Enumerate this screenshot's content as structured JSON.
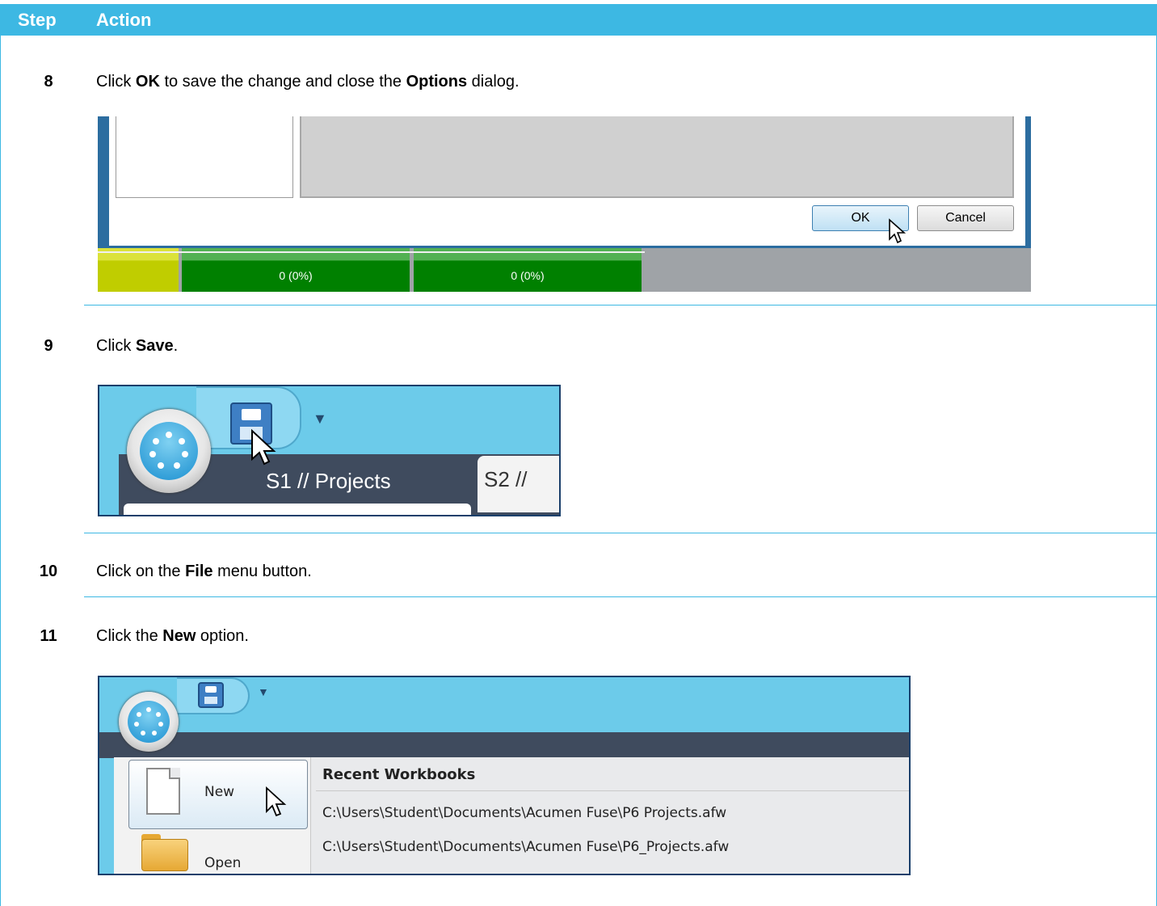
{
  "table": {
    "col_step": "Step",
    "col_action": "Action"
  },
  "steps": [
    {
      "number": "8",
      "text_before": "Click ",
      "bold1": "OK",
      "text_mid": " to save the change and close the ",
      "bold2": "Options",
      "text_after": " dialog."
    },
    {
      "number": "9",
      "text_before": "Click ",
      "bold1": "Save",
      "text_after": "."
    },
    {
      "number": "10",
      "text_before": "Click on the ",
      "bold1": "File",
      "text_after": " menu button."
    },
    {
      "number": "11",
      "text_before": "Click the ",
      "bold1": "New",
      "text_after": " option."
    }
  ],
  "shot1": {
    "ok_label": "OK",
    "cancel_label": "Cancel",
    "bar_labels": [
      "0 (0%)",
      "0 (0%)"
    ]
  },
  "shot2": {
    "tab1_label": "S1 // Projects",
    "tab2_label": "S2 //"
  },
  "shot3": {
    "new_label": "New",
    "open_label": "Open",
    "recent_title": "Recent Workbooks",
    "recent_files": [
      "C:\\Users\\Student\\Documents\\Acumen Fuse\\P6 Projects.afw",
      "C:\\Users\\Student\\Documents\\Acumen Fuse\\P6_Projects.afw"
    ]
  },
  "colors": {
    "header": "#3db8e3",
    "ribbon": "#6ccbea",
    "green": "#008000"
  }
}
